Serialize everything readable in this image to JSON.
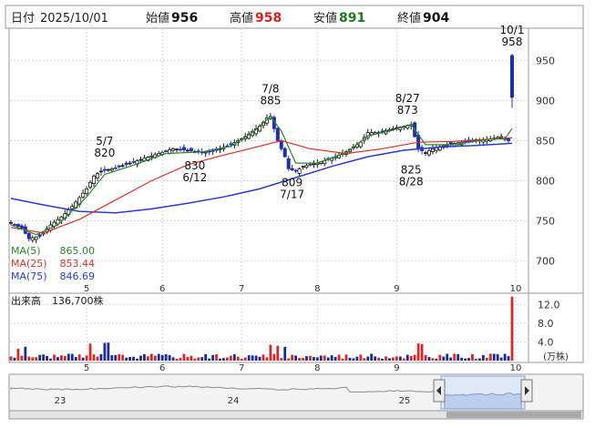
{
  "header": {
    "date_label": "日付",
    "date": "2025/10/01",
    "open_label": "始値",
    "open": "956",
    "high_label": "高値",
    "high": "958",
    "low_label": "安値",
    "low": "891",
    "close_label": "終値",
    "close": "904"
  },
  "ma_legend": [
    {
      "label": "MA(5)",
      "value": "865.00",
      "color": "#2a8a2a"
    },
    {
      "label": "MA(25)",
      "value": "853.44",
      "color": "#e0302a"
    },
    {
      "label": "MA(75)",
      "value": "846.69",
      "color": "#2a3ad8"
    }
  ],
  "volume_legend": {
    "label": "出来高",
    "value": "136,700株",
    "unit": "(万株)"
  },
  "colors": {
    "up": "#1a1a1a",
    "down": "#1f2fb0",
    "ma5": "#2a8a2a",
    "ma25": "#e0302a",
    "ma75": "#2a3ad8",
    "vol_up": "#d42a2a",
    "vol_down": "#1f2a90",
    "navigator_fill": "#bcd0ee",
    "grid": "#d8d8d8"
  },
  "chart_data": {
    "type": "candlestick",
    "price_axis": {
      "ticks": [
        "950",
        "900",
        "850",
        "800",
        "750",
        "700"
      ],
      "ylim": [
        660,
        990
      ]
    },
    "x_ticks": [
      "5",
      "6",
      "7",
      "8",
      "9",
      "10"
    ],
    "annotations": [
      {
        "date": "5/7",
        "value": "820",
        "kind": "high"
      },
      {
        "date": "6/12",
        "value": "830",
        "kind": "low"
      },
      {
        "date": "7/8",
        "value": "885",
        "kind": "high"
      },
      {
        "date": "7/17",
        "value": "809",
        "kind": "low"
      },
      {
        "date": "8/27",
        "value": "873",
        "kind": "high"
      },
      {
        "date": "8/28",
        "value": "825",
        "kind": "low"
      },
      {
        "date": "10/1",
        "value": "958",
        "kind": "high"
      }
    ],
    "close_series": [
      {
        "day": 1,
        "close": 748
      },
      {
        "day": 4,
        "close": 741
      },
      {
        "day": 6,
        "close": 728
      },
      {
        "day": 9,
        "close": 731
      },
      {
        "day": 12,
        "close": 745
      },
      {
        "day": 15,
        "close": 755
      },
      {
        "day": 18,
        "close": 768
      },
      {
        "day": 22,
        "close": 790
      },
      {
        "day": 24,
        "close": 806
      },
      {
        "day": 26,
        "close": 812
      },
      {
        "day": 30,
        "close": 816
      },
      {
        "day": 34,
        "close": 822
      },
      {
        "day": 38,
        "close": 828
      },
      {
        "day": 42,
        "close": 834
      },
      {
        "day": 46,
        "close": 840
      },
      {
        "day": 50,
        "close": 838
      },
      {
        "day": 54,
        "close": 835
      },
      {
        "day": 58,
        "close": 838
      },
      {
        "day": 62,
        "close": 845
      },
      {
        "day": 66,
        "close": 855
      },
      {
        "day": 70,
        "close": 868
      },
      {
        "day": 72,
        "close": 878
      },
      {
        "day": 73,
        "close": 880
      },
      {
        "day": 75,
        "close": 850
      },
      {
        "day": 77,
        "close": 830
      },
      {
        "day": 78,
        "close": 815
      },
      {
        "day": 80,
        "close": 812
      },
      {
        "day": 82,
        "close": 818
      },
      {
        "day": 86,
        "close": 822
      },
      {
        "day": 90,
        "close": 828
      },
      {
        "day": 94,
        "close": 836
      },
      {
        "day": 98,
        "close": 848
      },
      {
        "day": 100,
        "close": 860
      },
      {
        "day": 103,
        "close": 860
      },
      {
        "day": 107,
        "close": 865
      },
      {
        "day": 110,
        "close": 868
      },
      {
        "day": 112,
        "close": 870
      },
      {
        "day": 114,
        "close": 840
      },
      {
        "day": 116,
        "close": 835
      },
      {
        "day": 118,
        "close": 840
      },
      {
        "day": 122,
        "close": 845
      },
      {
        "day": 126,
        "close": 848
      },
      {
        "day": 130,
        "close": 850
      },
      {
        "day": 134,
        "close": 852
      },
      {
        "day": 137,
        "close": 855
      },
      {
        "day": 139,
        "close": 850
      },
      {
        "day": 140,
        "close": 904
      }
    ],
    "ma5": [
      {
        "day": 1,
        "v": 745
      },
      {
        "day": 8,
        "v": 733
      },
      {
        "day": 14,
        "v": 745
      },
      {
        "day": 22,
        "v": 780
      },
      {
        "day": 27,
        "v": 808
      },
      {
        "day": 34,
        "v": 818
      },
      {
        "day": 44,
        "v": 834
      },
      {
        "day": 54,
        "v": 836
      },
      {
        "day": 62,
        "v": 843
      },
      {
        "day": 68,
        "v": 860
      },
      {
        "day": 73,
        "v": 880
      },
      {
        "day": 76,
        "v": 862
      },
      {
        "day": 80,
        "v": 822
      },
      {
        "day": 86,
        "v": 822
      },
      {
        "day": 94,
        "v": 835
      },
      {
        "day": 100,
        "v": 856
      },
      {
        "day": 106,
        "v": 862
      },
      {
        "day": 112,
        "v": 870
      },
      {
        "day": 116,
        "v": 845
      },
      {
        "day": 124,
        "v": 845
      },
      {
        "day": 134,
        "v": 852
      },
      {
        "day": 138,
        "v": 852
      },
      {
        "day": 140,
        "v": 865
      }
    ],
    "ma25": [
      {
        "day": 1,
        "v": 742
      },
      {
        "day": 10,
        "v": 735
      },
      {
        "day": 20,
        "v": 752
      },
      {
        "day": 30,
        "v": 776
      },
      {
        "day": 40,
        "v": 800
      },
      {
        "day": 50,
        "v": 820
      },
      {
        "day": 60,
        "v": 832
      },
      {
        "day": 70,
        "v": 843
      },
      {
        "day": 76,
        "v": 850
      },
      {
        "day": 84,
        "v": 840
      },
      {
        "day": 94,
        "v": 834
      },
      {
        "day": 104,
        "v": 840
      },
      {
        "day": 114,
        "v": 848
      },
      {
        "day": 124,
        "v": 849
      },
      {
        "day": 134,
        "v": 852
      },
      {
        "day": 140,
        "v": 853.44
      }
    ],
    "ma75": [
      {
        "day": 1,
        "v": 778
      },
      {
        "day": 10,
        "v": 770
      },
      {
        "day": 20,
        "v": 762
      },
      {
        "day": 30,
        "v": 760
      },
      {
        "day": 40,
        "v": 765
      },
      {
        "day": 50,
        "v": 772
      },
      {
        "day": 60,
        "v": 780
      },
      {
        "day": 70,
        "v": 790
      },
      {
        "day": 80,
        "v": 804
      },
      {
        "day": 90,
        "v": 818
      },
      {
        "day": 100,
        "v": 830
      },
      {
        "day": 110,
        "v": 838
      },
      {
        "day": 120,
        "v": 842
      },
      {
        "day": 130,
        "v": 844
      },
      {
        "day": 140,
        "v": 846.69
      }
    ],
    "volume_axis": {
      "ticks": [
        "12.0",
        "8.0",
        "4.0"
      ],
      "ylim": [
        0,
        14
      ],
      "unit": "万株"
    },
    "volume_last": 13.67,
    "navigator_years": [
      "23",
      "24",
      "25"
    ]
  }
}
